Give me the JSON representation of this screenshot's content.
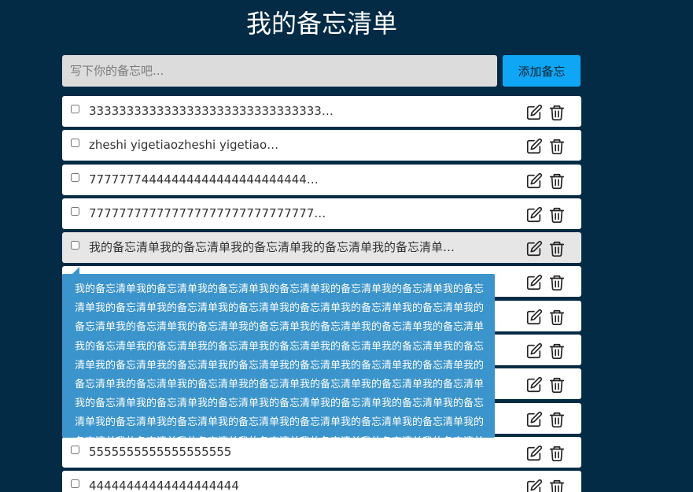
{
  "app": {
    "title": "我的备忘清单"
  },
  "composer": {
    "placeholder": "写下你的备忘吧...",
    "value": "",
    "add_label": "添加备忘"
  },
  "items": [
    {
      "text": "3333333333333333333333333333333…",
      "checked": false
    },
    {
      "text": "zheshi yigetiaozheshi yigetiao…",
      "checked": false
    },
    {
      "text": "77777774444444444444444444444…",
      "checked": false
    },
    {
      "text": "777777777777777777777777777777…",
      "checked": false
    },
    {
      "text": "我的备忘清单我的备忘清单我的备忘清单我的备忘清单我的备忘清单…",
      "checked": false
    },
    {
      "text": "",
      "checked": false
    },
    {
      "text": "",
      "checked": false
    },
    {
      "text": "",
      "checked": false
    },
    {
      "text": "",
      "checked": false
    },
    {
      "text": "",
      "checked": false
    },
    {
      "text": "5555555555555555555",
      "checked": false
    },
    {
      "text": "44444444444444444444",
      "checked": false
    }
  ],
  "tooltip": {
    "text": "我的备忘清单我的备忘清单我的备忘清单我的备忘清单我的备忘清单我的备忘清单我的备忘清单我的备忘清单我的备忘清单我的备忘清单我的备忘清单我的备忘清单我的备忘清单我的备忘清单我的备忘清单我的备忘清单我的备忘清单我的备忘清单我的备忘清单我的备忘清单我的备忘清单我的备忘清单我的备忘清单我的备忘清单我的备忘清单我的备忘清单我的备忘清单我的备忘清单我的备忘清单我的备忘清单我的备忘清单我的备忘清单我的备忘清单我的备忘清单我的备忘清单我的备忘清单我的备忘清单我的备忘清单我的备忘清单我的备忘清单我的备忘清单我的备忘清单我的备忘清单我的备忘清单我的备忘清单我的备忘清单我的备忘清单我的备忘清单我的备忘清单我的备忘清单我的备忘清单我的备忘清单我的备忘清单我的备忘清单我的备忘清单我的备忘清单我的备忘清单我的备忘清单我的备忘清单我的备忘清单"
  },
  "icons": {
    "edit": "edit-icon",
    "delete": "trash-icon"
  },
  "colors": {
    "background": "#032b45",
    "accent": "#0fa7f5",
    "tooltip": "#3b94cb",
    "item_hover": "#e6e6e6"
  }
}
